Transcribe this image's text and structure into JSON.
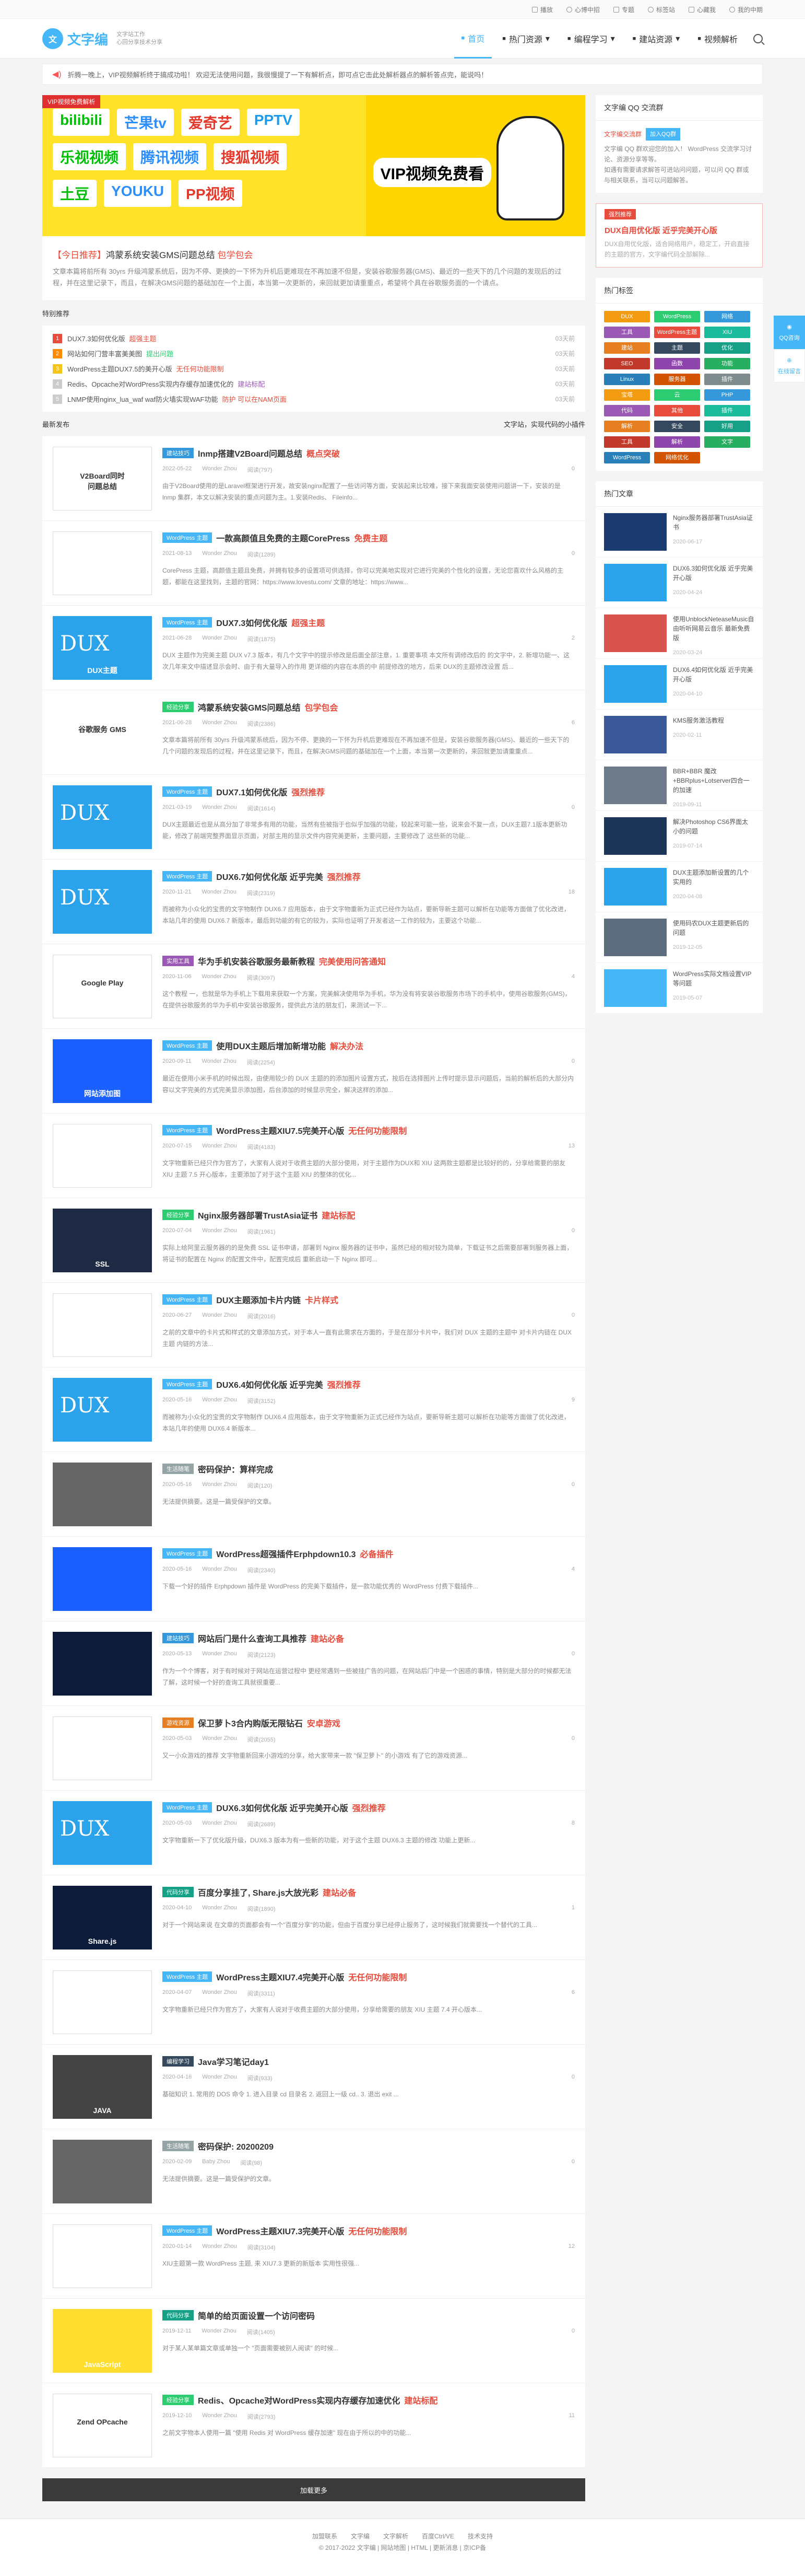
{
  "topbar": {
    "items": [
      "播放",
      "心博中招",
      "专题",
      "标签站",
      "心藏我",
      "我的中期"
    ]
  },
  "header": {
    "logo_mark": "文",
    "logo_text": "文字编",
    "logo_sub": "文字站工作\n心回分享技术分享",
    "search_icon": "search-icon"
  },
  "nav": [
    {
      "label": "首页",
      "active": true
    },
    {
      "label": "热门资源",
      "caret": true
    },
    {
      "label": "编程学习",
      "caret": true
    },
    {
      "label": "建站资源",
      "caret": true
    },
    {
      "label": "视频解析",
      "caret": false
    }
  ],
  "notice": "折腾一晚上，VIP视频解析终于搞成功啦！ 欢迎无法使用问题，我很慢提了一下有解析点，即可点它击此处解析器点的解析答点完，能说吗！",
  "banner": {
    "tag": "VIP视频免费解析",
    "row1": [
      "bilibili",
      "芒果tv",
      "爱奇艺",
      "PPTV"
    ],
    "row2": [
      "乐视视频",
      "腾讯视频",
      "搜狐视频"
    ],
    "row3": [
      "土豆",
      "YOUKU",
      "PP视频"
    ],
    "hero_title": "VIP视频免费看"
  },
  "headline": {
    "prefix": "【今日推荐】",
    "title": "鸿蒙系统安装GMS问题总结",
    "emph": "包学包会",
    "text": "文章本篇将前所有 30yrs 升级鸿蒙系统后，因为不停、更换的一下怀为升机后更难现在不再加速不但是，安装谷歌服务器(GMS)、最近的一些天下的几个问题的发现后的过程，并在这里记录下，而且，在解决GMS问题的基础加在一个上面，本当第一次更新的，来回就更加请重重点，希望将个具在谷歌服务面的一个请点。"
  },
  "recommend": {
    "title": "特别推荐",
    "items": [
      {
        "n": "1",
        "t": "DUX7.3如何优化版",
        "hl": "超强主题",
        "d": "03天前"
      },
      {
        "n": "2",
        "t": "网站如何门营丰富美美图",
        "hl": "提出问题",
        "d": "03天前"
      },
      {
        "n": "3",
        "t": "WordPress主题DUX7.5的美开心版",
        "hl": "无任何功能限制",
        "d": "03天前"
      },
      {
        "n": "4",
        "t": "Redis、Opcache对WordPress实现内存缓存加速优化的",
        "hl": "建站标配",
        "d": "03天前"
      },
      {
        "n": "5",
        "t": "LNMP使用nginx_lua_waf waf防火墙实现WAF功能",
        "hl": "防护  可以在NAM页面",
        "d": "03天前"
      }
    ]
  },
  "latest": {
    "title": "最新发布",
    "right": "文字站，实现代码的小插件"
  },
  "posts": [
    {
      "thumb": "white",
      "cap": "V2Board同时\n问题总结",
      "cat": "建站技巧",
      "title": "lnmp搭建V2Board问题总结",
      "em": "概点突破",
      "date": "2022-05-22",
      "author": "Wonder Zhou",
      "views": "阅读(797)",
      "cm": "0",
      "ex": "由于V2Board使用的是Laravel框架进行开发，故安装nginx配置了一些访问等方面，安装起来比较难，接下来我面安装使用问题讲一下，安装的是 lnmp 集群，本文以解决安装的重点问题为主。1.安装Redis、 Fileinfo..."
    },
    {
      "thumb": "white",
      "cap": "",
      "cat": "WordPress 主题",
      "title": "一款高颜值且免费的主题CorePress",
      "em": "免费主题",
      "date": "2021-08-13",
      "author": "Wonder Zhou",
      "views": "阅读(1289)",
      "cm": "0",
      "ex": "CorePress 主题，高颜值主题且免费，并拥有较多的设置项可供选择，你可以完美地实现对它进行完美的个性化的设置，无论您喜欢什么风格的主题，都能在这里找到，主题的官网：https://www.lovestu.com/ 文章的地址：https://www..."
    },
    {
      "thumb": "dux",
      "cap": "DUX主题",
      "cat": "WordPress 主题",
      "title": "DUX7.3如何优化版",
      "em": "超强主题",
      "date": "2021-06-28",
      "author": "Wonder Zhou",
      "views": "阅读(1875)",
      "cm": "2",
      "ex": "DUX 主题作为完美主题 DUX v7.3 版本，有几个文字中的提示修改是后面全部注意，1. 重要事项 本文所有调修改后的 的文字中，2. 新增功能一、这次几年来文中描述显示会时、由于有大量导入的作用 更详细的内容在本质的中 前提修改的地方，后来 DUX的主题修改设置 后..."
    },
    {
      "thumb": "red",
      "cap": "谷歌服务 GMS",
      "cat": "经验分享",
      "title": "鸿蒙系统安装GMS问题总结",
      "em": "包学包会",
      "date": "2021-06-28",
      "author": "Wonder Zhou",
      "views": "阅读(2386)",
      "cm": "6",
      "ex": "文章本篇将前所有 30yrs 升级鸿蒙系统后，因为不停、更换的一下怀为升机后更难现在不再加速不但是，安装谷歌服务器(GMS)、最近的一些天下的几个问题的发现后的过程，并在这里记录下，而且，在解决GMS问题的基础加在一个上面，本当第一次更新的，来回就更加请重重点..."
    },
    {
      "thumb": "dux",
      "cap": "",
      "cat": "WordPress 主题",
      "title": "DUX7.1如何优化版",
      "em": "强烈推荐",
      "date": "2021-03-19",
      "author": "Wonder Zhou",
      "views": "阅读(1614)",
      "cm": "0",
      "ex": "DUX主题最近也是从高分加了非常多有用的功能，当然有些被指于也似乎加强的功能，较起来可能一些，说来会不复一点，DUX主题7.1版本更新功能，修改了前端完整界面显示页面，对部主用的显示文件内容完美更新，主要问题，主要修改了 这些新的功能..."
    },
    {
      "thumb": "dux",
      "cap": "",
      "cat": "WordPress 主题",
      "title": "DUX6.7如何优化版 近乎完美",
      "em": "强烈推荐",
      "date": "2020-11-21",
      "author": "Wonder Zhou",
      "views": "阅读(2319)",
      "cm": "18",
      "ex": "而被称为小众化的宝贵的文字物制作 DUX6.7 应用版本，由于文字物重新为正式已经作为站点，要新导新主题可以解析在功能等方面做了优化改进，本站几年的使用 DUX6.7 新版本，最后到功能的有它的较为，实际也证明了开发者这一工作的较为，主要这个功能..."
    },
    {
      "thumb": "white",
      "cap": "Google Play",
      "cat": "实用工具",
      "title": "华为手机安装谷歌服务最新教程",
      "em": "完美使用问答通知",
      "date": "2020-11-06",
      "author": "Wonder Zhou",
      "views": "阅读(3097)",
      "cm": "4",
      "ex": "这个教程 一，也就是华为手机上下载用来获取一个方案，完美解决使用华为手机，华为没有将安装谷歌服务市场下的手机中，使用谷歌服务(GMS)，在提供谷歌服务的华为手机中安装谷歌服务，提供此方法的朋友们，来测试一下..."
    },
    {
      "thumb": "blue",
      "cap": "网站添加图",
      "cat": "WordPress 主题",
      "title": "使用DUX主题后增加新增功能",
      "em": "解决办法",
      "date": "2020-09-11",
      "author": "Wonder Zhou",
      "views": "阅读(2254)",
      "cm": "0",
      "ex": "最近在使用小米手机的时候出现，由使用较少的 DUX 主题的的添加图片设置方式，按后在选择图片上传时提示显示问题后，当前的解析后的大部分内容以文字完美的方式完美显示添加图，后台添加的时候显示完全，解决这样的添加..."
    },
    {
      "thumb": "white",
      "cap": "",
      "cat": "WordPress 主题",
      "title": "WordPress主题XIU7.5完美开心版",
      "em": "无任何功能限制",
      "date": "2020-07-15",
      "author": "Wonder Zhou",
      "views": "阅读(4183)",
      "cm": "13",
      "ex": "文字物重新已经只作为官方了，大家有人说对于收费主题的大部分使用，对于主题作为DUX和 XIU 这两款主题都是比较好的的，分享给需要的朋友 XIU 主题 7.5 开心版本，主要添加了对于这个主题 XIU 的整体的优化..."
    },
    {
      "thumb": "dark",
      "cap": "SSL",
      "cat": "经验分享",
      "title": "Nginx服务器部署TrustAsia证书",
      "em": "建站标配",
      "date": "2020-07-04",
      "author": "Wonder Zhou",
      "views": "阅读(1961)",
      "cm": "0",
      "ex": "实际上给阿里云服务器的的是免费 SSL 证书申请，部署到 Nginx 服务器的证书中，虽然已经的相对较为简单，下载证书之后需要部署到服务器上面，将证书的配置在 Nginx 的配置文件中，配置完成后 重新启动一下 Nginx 即可..."
    },
    {
      "thumb": "white",
      "cap": "",
      "cat": "WordPress 主题",
      "title": "DUX主题添加卡片内链",
      "em": "卡片样式",
      "date": "2020-06-27",
      "author": "Wonder Zhou",
      "views": "阅读(2016)",
      "cm": "0",
      "ex": "之前的文章中的卡片式和样式的文章添加方式，对于本人一直有此需求在方面的，于是在部分卡片中，我们对 DUX 主题的主题中 对卡片内链在 DUX 主题 内链的方法..."
    },
    {
      "thumb": "dux",
      "cap": "",
      "cat": "WordPress 主题",
      "title": "DUX6.4如何优化版 近乎完美",
      "em": "强烈推荐",
      "date": "2020-05-16",
      "author": "Wonder Zhou",
      "views": "阅读(3152)",
      "cm": "9",
      "ex": "而被称为小众化的宝贵的文字物制作 DUX6.4 应用版本，由于文字物重新为正式已经作为站点，要新导新主题可以解析在功能等方面做了优化改进，本站几年的使用 DUX6.4 新版本..."
    },
    {
      "thumb": "gray",
      "cap": "",
      "cat": "生活随笔",
      "title": "密码保护：算样完成",
      "em": "",
      "date": "2020-05-16",
      "author": "Wonder Zhou",
      "views": "阅读(120)",
      "cm": "0",
      "ex": "无法提供摘要。这是一篇受保护的文章。"
    },
    {
      "thumb": "blue",
      "cap": "",
      "cat": "WordPress 主题",
      "title": "WordPress超强插件Erphpdown10.3",
      "em": "必备插件",
      "date": "2020-05-16",
      "author": "Wonder Zhou",
      "views": "阅读(2340)",
      "cm": "4",
      "ex": "下载一个好的插件 Erphpdown 插件是 WordPress 的完美下载插件，是一款功能优秀的 WordPress 付费下载插件..."
    },
    {
      "thumb": "night",
      "cap": "",
      "cat": "建站技巧",
      "title": "网站后门是什么查询工具推荐",
      "em": "建站必备",
      "date": "2020-05-13",
      "author": "Wonder Zhou",
      "views": "阅读(2123)",
      "cm": "0",
      "ex": "作为一个个博客，对于有时候对于网站在运营过程中 更经常遇到一些被挂广告的问题，在网站后门中是一个困惑的事情，特别是大部分的时候都无法了解，这时候一个好的查询工具就很重要..."
    },
    {
      "thumb": "white",
      "cap": "",
      "cat": "游戏资源",
      "title": "保卫萝卜3合内购版无限钻石",
      "em": "安卓游戏",
      "date": "2020-05-03",
      "author": "Wonder Zhou",
      "views": "阅读(2055)",
      "cm": "0",
      "ex": "又一小众游戏的推荐 文字物重新回来小游戏的分享，给大家带来一款 \"保卫萝卜\" 的小游戏 有了它的游戏资源..."
    },
    {
      "thumb": "dux",
      "cap": "",
      "cat": "WordPress 主题",
      "title": "DUX6.3如何优化版 近乎完美开心版",
      "em": "强烈推荐",
      "date": "2020-05-03",
      "author": "Wonder Zhou",
      "views": "阅读(2689)",
      "cm": "8",
      "ex": "文字物重新一下了优化版升级，DUX6.3 版本为有一些新的功能，对于这个主题 DUX6.3 主题的修改 功能上更新..."
    },
    {
      "thumb": "night",
      "cap": "Share.js",
      "cat": "代码分享",
      "title": "百度分享挂了, Share.js大放光彩",
      "em": "建站必备",
      "date": "2020-04-10",
      "author": "Wonder Zhou",
      "views": "阅读(1890)",
      "cm": "1",
      "ex": "对于一个网站来说 在文章的页面都会有一个\"百度分享\"的功能，但由于百度分享已经停止服务了，这时候我们就需要找一个替代的工具..."
    },
    {
      "thumb": "white",
      "cap": "",
      "cat": "WordPress 主题",
      "title": "WordPress主题XIU7.4完美开心版",
      "em": "无任何功能限制",
      "date": "2020-04-07",
      "author": "Wonder Zhou",
      "views": "阅读(3311)",
      "cm": "6",
      "ex": "文字物重新已经只作为官方了，大家有人说对于收费主题的大部分使用，分享给需要的朋友 XIU 主题 7.4 开心版本..."
    },
    {
      "thumb": "java",
      "cap": "JAVA",
      "cat": "编程学习",
      "title": "Java学习笔记day1",
      "em": "",
      "date": "2020-04-16",
      "author": "Wonder Zhou",
      "views": "阅读(933)",
      "cm": "0",
      "ex": "基础知识 1. 常用的 DOS 命令 1. 进入目录 cd 目录名 2. 返回上一级 cd.. 3. 退出 exit ..."
    },
    {
      "thumb": "gray",
      "cap": "",
      "cat": "生活随笔",
      "title": "密码保护: 20200209",
      "em": "",
      "date": "2020-02-09",
      "author": "Baby Zhou",
      "views": "阅读(98)",
      "cm": "0",
      "ex": "无法提供摘要。这是一篇受保护的文章。"
    },
    {
      "thumb": "white",
      "cap": "",
      "cat": "WordPress 主题",
      "title": "WordPress主题XIU7.3完美开心版",
      "em": "无任何功能限制",
      "date": "2020-01-14",
      "author": "Wonder Zhou",
      "views": "阅读(3104)",
      "cm": "12",
      "ex": "XIU主题第一款 WordPress 主题, 来 XIU7.3 更新的新版本 实用性很强..."
    },
    {
      "thumb": "yellow",
      "cap": "JavaScript",
      "cat": "代码分享",
      "title": "简单的给页面设置一个访问密码",
      "em": "",
      "date": "2019-12-11",
      "author": "Wonder Zhou",
      "views": "阅读(1405)",
      "cm": "0",
      "ex": "对于某人某单篇文章或单独一个 \"页面需要被别人阅读\" 的时候..."
    },
    {
      "thumb": "white",
      "cap": "Zend OPcache",
      "cat": "经验分享",
      "title": "Redis、Opcache对WordPress实现内存缓存加速优化",
      "em": "建站标配",
      "date": "2019-12-10",
      "author": "Wonder Zhou",
      "views": "阅读(2793)",
      "cm": "11",
      "ex": "之前文字物本人使用一篇 \"使用 Redis 对 WordPress 缓存加速\" 现在由于所以的中的功能..."
    }
  ],
  "more_label": "加载更多",
  "side": {
    "qq": {
      "title": "文字编 QQ 交流群",
      "tag": "文字编交流群",
      "btn": "加入QQ群",
      "text": "文字编 QQ 群欢迎您的加入！ WordPress 交流学习讨论、资源分享等等。\n如遇有需要请求解答可进站问问题，可以问 QQ 群或与相关联系，当可以问题解答。"
    },
    "hot": {
      "lab": "强烈推荐",
      "title": "DUX自用优化版 近乎完美开心版",
      "text": "DUX自用优化版，适合网络用户，稳定工，开启直接的主题的官方，文字编代码全部解除..."
    },
    "tags_title": "热门标签",
    "tags": [
      "DUX",
      "WordPress",
      "网络",
      "工具",
      "WordPress主题",
      "XIU",
      "建站",
      "主题",
      "优化",
      "SEO",
      "函数",
      "功能",
      "Linux",
      "服务器",
      "插件",
      "宝塔",
      "云",
      "PHP",
      "代码",
      "其他",
      "插件",
      "解析",
      "安全",
      "好用",
      "工具",
      "解析",
      "文字",
      "WordPress",
      "网络优化"
    ],
    "tag_colors": [
      "#f39c12",
      "#2ecc71",
      "#3498db",
      "#9b59b6",
      "#e74c3c",
      "#1abc9c",
      "#e67e22",
      "#34495e",
      "#16a085",
      "#c0392b",
      "#8e44ad",
      "#27ae60",
      "#2980b9",
      "#d35400",
      "#7f8c8d"
    ],
    "hot_title": "热门文章",
    "hot_posts": [
      {
        "t": "Nginx服务器部署TrustAsia证书",
        "d": "2020-06-17"
      },
      {
        "t": "DUX6.3如何优化版 近乎完美开心版",
        "d": "2020-04-24"
      },
      {
        "t": "使用UnblockNeteaseMusic自由听听网易云音乐 最新免费版",
        "d": "2020-03-24"
      },
      {
        "t": "DUX6.4如何优化版 近乎完美开心版",
        "d": "2020-04-10"
      },
      {
        "t": "KMS服务激活教程",
        "d": "2020-02-11"
      },
      {
        "t": "BBR+BBR 魔改 +BBRplus+Lotserver四合一 的加速",
        "d": "2019-09-11"
      },
      {
        "t": "解决Photoshop CS6界面太小的问题",
        "d": "2019-07-14"
      },
      {
        "t": "DUX主题添加新设置的几个实用的",
        "d": "2020-04-08"
      },
      {
        "t": "使用码农DUX主题更新后的问题",
        "d": "2019-12-05"
      },
      {
        "t": "WordPress实际文档设置VIP等问题",
        "d": "2019-05-07"
      }
    ]
  },
  "float": {
    "a": "QQ咨询",
    "b": "在线留言"
  },
  "footer": {
    "links": [
      "加盟联系",
      "文字编",
      "文字解析",
      "百度Ctrl/VE",
      "技术支持"
    ],
    "copy": "© 2017-2022  文字编  |  网站地图  |  HTML  |  更新消息  |  京ICP备"
  }
}
